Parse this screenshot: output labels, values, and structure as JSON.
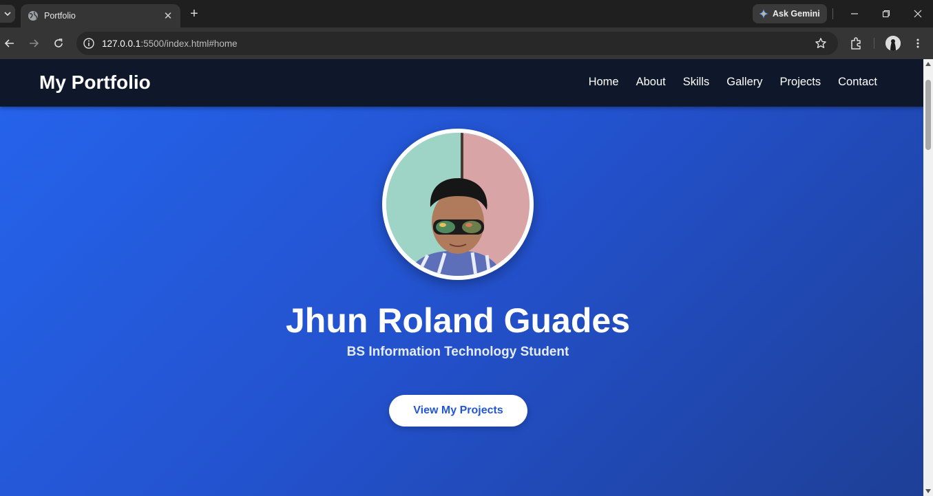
{
  "browser": {
    "tab_title": "Portfolio",
    "new_tab_symbol": "+",
    "gemini_label": "Ask Gemini",
    "url_host": "127.0.0.1",
    "url_path": ":5500/index.html#home"
  },
  "site": {
    "brand": "My Portfolio",
    "nav": [
      "Home",
      "About",
      "Skills",
      "Gallery",
      "Projects",
      "Contact"
    ],
    "hero": {
      "name": "Jhun Roland Guades",
      "role": "BS Information Technology Student",
      "cta_label": "View My Projects"
    }
  },
  "colors": {
    "nav_bg": "#0f172a",
    "hero_start": "#2563eb",
    "hero_end": "#1e3f96",
    "cta_text": "#2256d6"
  },
  "icons": [
    "tab-search-icon",
    "globe-icon",
    "close-icon",
    "gemini-spark-icon",
    "minimize-icon",
    "restore-icon",
    "window-close-icon",
    "back-icon",
    "forward-icon",
    "reload-icon",
    "site-info-icon",
    "bookmark-star-icon",
    "extensions-icon",
    "kebab-menu-icon"
  ]
}
